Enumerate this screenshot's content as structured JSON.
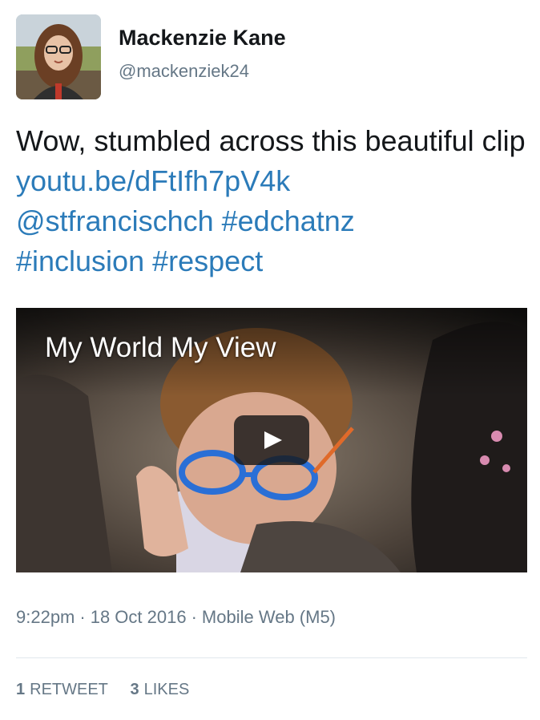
{
  "user": {
    "name": "Mackenzie Kane",
    "handle": "@mackenziek24"
  },
  "tweet": {
    "text_prefix": "Wow, stumbled across this beautiful clip",
    "link": "youtu.be/dFtIfh7pV4k",
    "mention": "@stfrancischch",
    "hashtags": [
      "#edchatnz",
      "#inclusion",
      "#respect"
    ]
  },
  "media": {
    "video_title": "My World My View"
  },
  "meta": {
    "time": "9:22pm",
    "separator": "·",
    "date": "18 Oct 2016",
    "source": "Mobile Web (M5)"
  },
  "stats": {
    "retweets_count": "1",
    "retweets_label": "Retweet",
    "likes_count": "3",
    "likes_label": "Likes"
  },
  "colors": {
    "link": "#2b7bb9",
    "secondary_text": "#657786",
    "divider": "#e1e8ed"
  }
}
